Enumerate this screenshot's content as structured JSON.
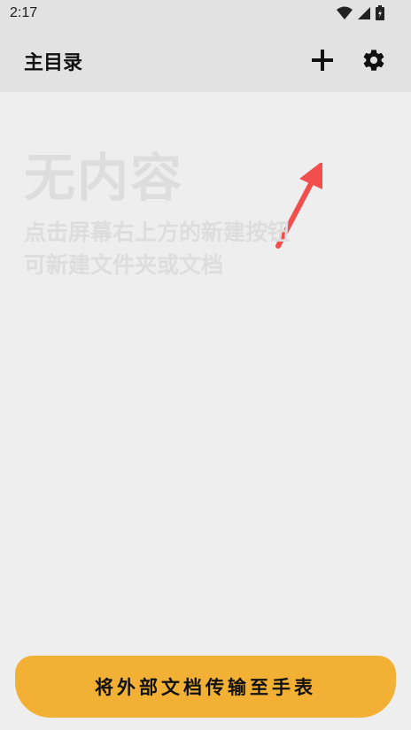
{
  "status_bar": {
    "time": "2:17",
    "icons": [
      "wifi-icon",
      "signal-icon",
      "battery-icon"
    ]
  },
  "app_bar": {
    "title": "主目录",
    "actions": [
      "add-icon",
      "settings-icon"
    ]
  },
  "empty_state": {
    "title": "无内容",
    "hint_line1": "点击屏幕右上方的新建按钮",
    "hint_line2": "可新建文件夹或文档"
  },
  "annotation": {
    "arrow_color": "#f24e4e"
  },
  "bottom_button": {
    "label": "将外部文档传输至手表",
    "color": "#f2b134"
  }
}
